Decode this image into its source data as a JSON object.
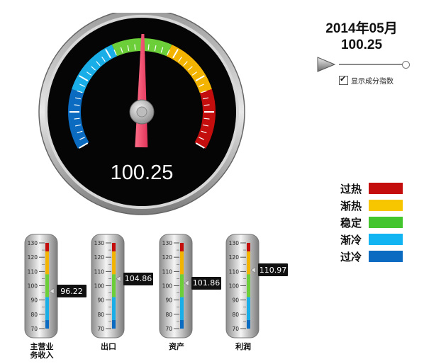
{
  "gauge": {
    "value": 100.25,
    "value_text": "100.25",
    "min": 60,
    "max": 140,
    "bands": [
      {
        "name": "过冷",
        "from": 60,
        "to": 76,
        "color": "#0a6bc0"
      },
      {
        "name": "渐冷",
        "from": 76,
        "to": 92,
        "color": "#19aee8"
      },
      {
        "name": "稳定",
        "from": 92,
        "to": 108,
        "color": "#6ccf3a"
      },
      {
        "name": "渐热",
        "from": 108,
        "to": 124,
        "color": "#f2b400"
      },
      {
        "name": "过热",
        "from": 124,
        "to": 140,
        "color": "#c40e0e"
      }
    ]
  },
  "header": {
    "date": "2014年05月",
    "value": "100.25"
  },
  "controls": {
    "play_icon": "play-icon",
    "slider_position": 1.0,
    "checkbox_checked": true,
    "checkbox_label": "显示成分指数"
  },
  "legend": [
    {
      "label": "过热",
      "color": "#c40e0e"
    },
    {
      "label": "渐热",
      "color": "#f7c600"
    },
    {
      "label": "稳定",
      "color": "#43c52d"
    },
    {
      "label": "渐冷",
      "color": "#12b4f2"
    },
    {
      "label": "过冷",
      "color": "#0a6bc0"
    }
  ],
  "thermometers": {
    "scale_min": 70,
    "scale_max": 130,
    "ticks": [
      "130",
      "120",
      "110",
      "100",
      "90",
      "80",
      "70"
    ],
    "items": [
      {
        "label_lines": [
          "主营业",
          "务收入"
        ],
        "value": 96.22,
        "value_text": "96.22"
      },
      {
        "label_lines": [
          "出口"
        ],
        "value": 104.86,
        "value_text": "104.86"
      },
      {
        "label_lines": [
          "资产"
        ],
        "value": 101.86,
        "value_text": "101.86"
      },
      {
        "label_lines": [
          "利润"
        ],
        "value": 110.97,
        "value_text": "110.97"
      }
    ]
  }
}
